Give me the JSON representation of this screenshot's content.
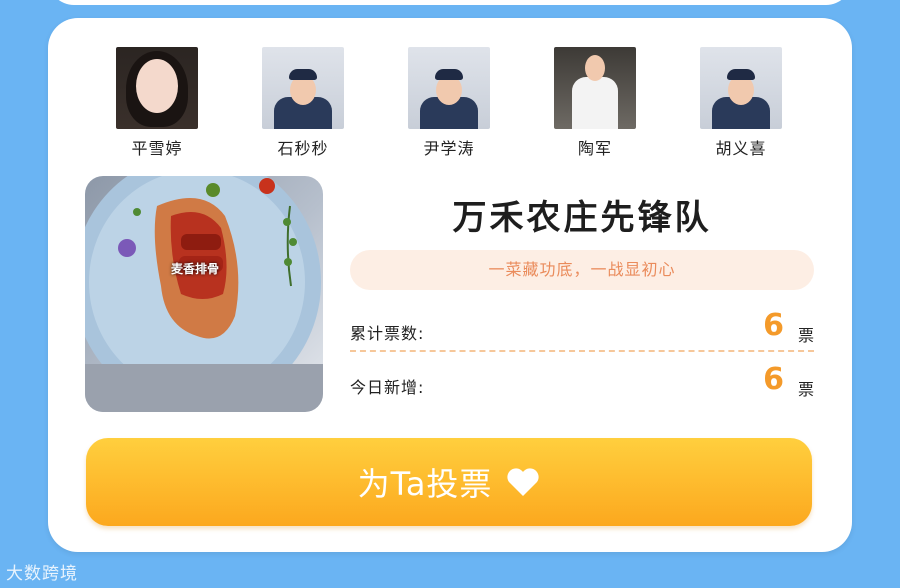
{
  "members": [
    {
      "name": "平雪婷",
      "icon": "avatar-photo-woman"
    },
    {
      "name": "石秒秒",
      "icon": "avatar-photo-chef"
    },
    {
      "name": "尹学涛",
      "icon": "avatar-photo-chef"
    },
    {
      "name": "陶军",
      "icon": "avatar-photo-chef-white"
    },
    {
      "name": "胡义喜",
      "icon": "avatar-photo-chef"
    }
  ],
  "dish": {
    "label": "麦香排骨"
  },
  "team": {
    "title": "万禾农庄先锋队",
    "slogan": "一菜藏功底，一战显初心"
  },
  "stats": {
    "total_label": "累计票数:",
    "total_value": "6",
    "total_unit": "票",
    "today_label": "今日新增:",
    "today_value": "6",
    "today_unit": "票"
  },
  "vote": {
    "label": "为Ta投票",
    "icon": "heart-icon"
  },
  "watermark": "大数跨境",
  "colors": {
    "background": "#6ab4f3",
    "accent": "#f49a2a",
    "button_top": "#ffcf3e",
    "button_bottom": "#fca81e",
    "slogan_text": "#ea8b5b",
    "slogan_bg": "#fdeee4"
  }
}
